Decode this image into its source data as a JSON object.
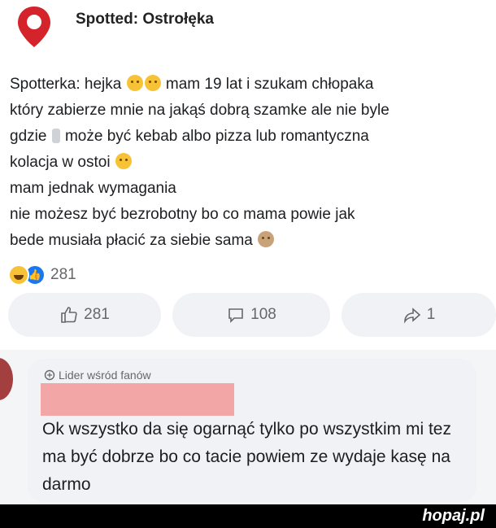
{
  "page": {
    "title": "Spotted: Ostrołęka"
  },
  "post": {
    "lines": [
      "Spotterka: hejka",
      " mam 19 lat i szukam chłopaka",
      "który zabierze mnie na jakąś dobrą szamke ale nie byle",
      "gdzie",
      " może być kebab albo pizza lub romantyczna",
      "kolacja w ostoi",
      "mam jednak wymagania",
      "nie możesz być bezrobotny bo co mama powie jak",
      "bede musiała płacić za siebie sama"
    ]
  },
  "reactions": {
    "count": "281"
  },
  "actions": {
    "like_count": "281",
    "comment_count": "108",
    "share_count": "1"
  },
  "comment": {
    "badge": "Lider wśród fanów",
    "text": "Ok wszystko da się ogarnąć tylko po wszystkim mi tez ma być dobrze bo co tacie powiem ze wydaje kasę na darmo"
  },
  "watermark": "hopaj.pl",
  "colors": {
    "pin": "#d4232a",
    "like_blue": "#1877f2",
    "redaction": "#f2a6a6",
    "button_bg": "#f0f2f5"
  }
}
